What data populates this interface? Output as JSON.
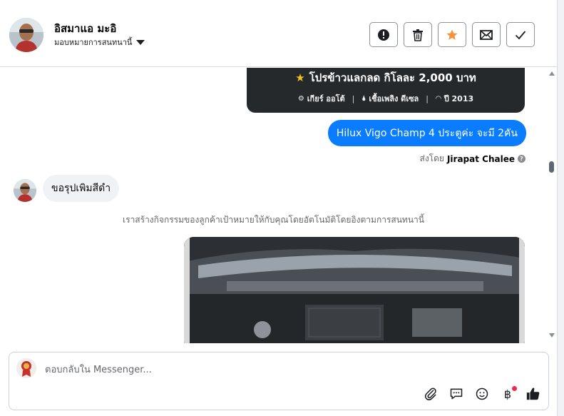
{
  "header": {
    "contact_name": "อิสมาแอ มะอิ",
    "assignment_label": "มอบหมายการสนทนานี้",
    "toolbar": [
      {
        "name": "spam-button",
        "icon": "alert-circle-icon"
      },
      {
        "name": "delete-button",
        "icon": "trash-icon"
      },
      {
        "name": "star-button",
        "icon": "star-icon",
        "color": "#f7923a"
      },
      {
        "name": "mark-unread-button",
        "icon": "envelope-icon"
      },
      {
        "name": "mark-done-button",
        "icon": "check-icon"
      }
    ]
  },
  "chat": {
    "promo_card": {
      "title": "โปรข้าวแลกลด กิโลละ 2,000 บาท",
      "specs": [
        {
          "icon": "gear-icon",
          "text": "เกียร์ ออโต้"
        },
        {
          "icon": "fuel-icon",
          "text": "เชื้อเพลิง ดีเซล"
        },
        {
          "icon": "gauge-icon",
          "text": "ปี 2013"
        }
      ]
    },
    "outgoing_message": "Hilux Vigo Champ 4 ประตูค่ะ จะมี 2คัน",
    "sent_by_label": "ส่งโดย",
    "sent_by_name": "Jirapat Chalee",
    "incoming_message": "ขอรุปเพิมสีดำ",
    "system_note": "เราสร้างกิจกรรมของลูกค้าเป้าหมายให้กับคุณโดยอัตโนมัติโดยอิงตามการสนทนานี้",
    "photo": "engine-bay-photo"
  },
  "composer": {
    "placeholder": "ตอบกลับใน Messenger...",
    "actions": [
      "paperclip-icon",
      "chat-bubble-icon",
      "smiley-icon",
      "baht-icon",
      "thumbs-up-icon"
    ],
    "baht_symbol": "฿",
    "notification_color": "#f02849"
  },
  "colors": {
    "accent": "#0a7cff",
    "card_bg": "#26292c"
  }
}
